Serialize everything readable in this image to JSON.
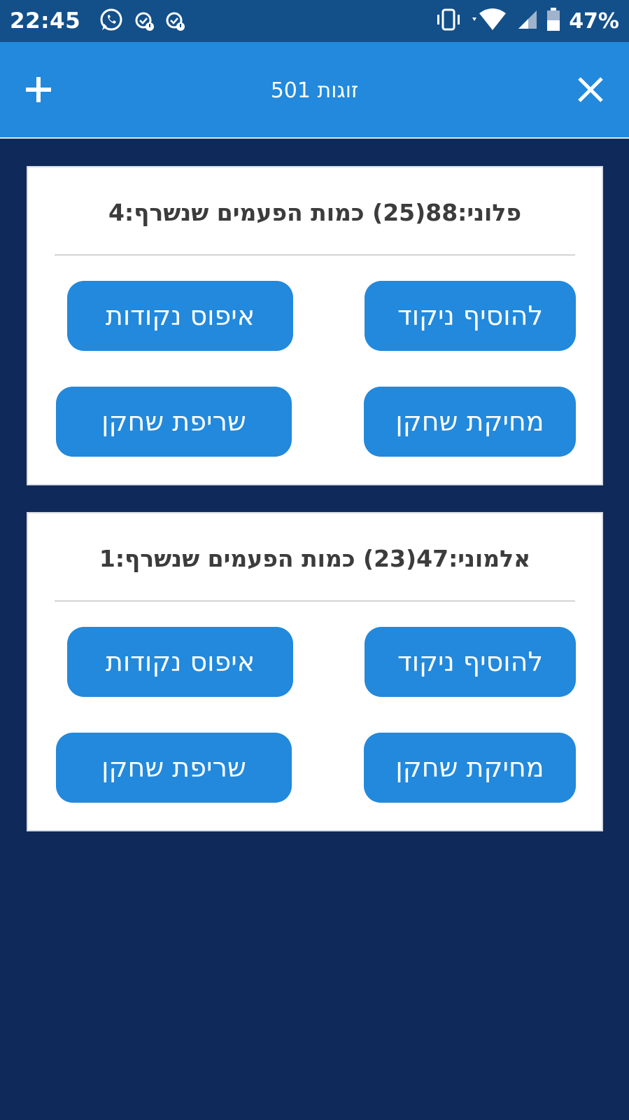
{
  "status_bar": {
    "time": "22:45",
    "battery_percent": "47%",
    "icons": [
      "whatsapp-icon",
      "alarm-icon",
      "alarm-icon",
      "vibrate-icon",
      "wifi-icon",
      "signal-icon",
      "battery-icon"
    ]
  },
  "app_bar": {
    "title": "501 זוגות",
    "add_icon": "plus-icon",
    "close_icon": "close-icon",
    "background": "#2289dc"
  },
  "players": [
    {
      "title": "פלוני:88(25)  כמות הפעמים שנשרף:4",
      "add_score": "להוסיף ניקוד",
      "reset_points": "איפוס נקודות",
      "delete_player": "מחיקת שחקן",
      "burn_player": "שריפת שחקן"
    },
    {
      "title": "אלמוני:47(23)  כמות הפעמים שנשרף:1",
      "add_score": "להוסיף ניקוד",
      "reset_points": "איפוס נקודות",
      "delete_player": "מחיקת שחקן",
      "burn_player": "שריפת שחקן"
    }
  ],
  "colors": {
    "background": "#0f2a5a",
    "status_bar": "#13508a",
    "button": "#2289dc"
  }
}
